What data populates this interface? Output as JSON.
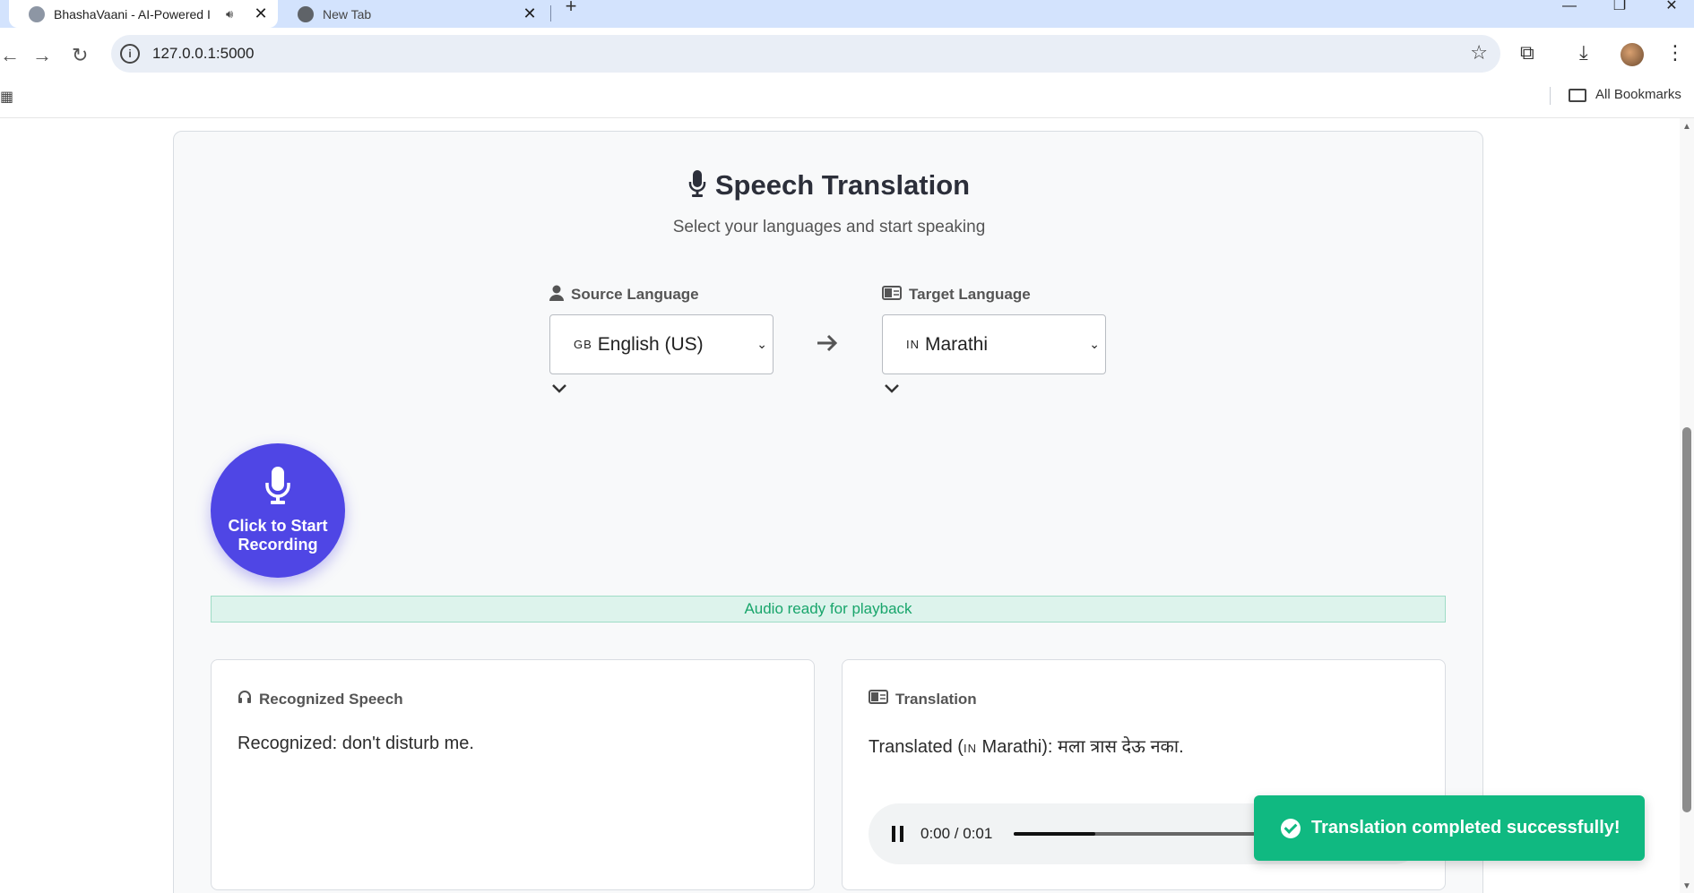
{
  "browser": {
    "tabs": [
      {
        "title": "BhashaVaani - AI-Powered I",
        "active": true
      },
      {
        "title": "New Tab",
        "active": false
      }
    ],
    "new_tab_symbol": "+",
    "url": "127.0.0.1:5000",
    "bookmarks_label": "All Bookmarks"
  },
  "page": {
    "title": "Speech Translation",
    "subtitle": "Select your languages and start speaking",
    "source": {
      "label": "Source Language",
      "flag": "GB",
      "value": "English (US)"
    },
    "target": {
      "label": "Target Language",
      "flag": "IN",
      "value": "Marathi"
    },
    "record_button": "Click to Start Recording",
    "status": "Audio ready for playback",
    "recognized": {
      "heading": "Recognized Speech",
      "text": "Recognized: don't disturb me."
    },
    "translation": {
      "heading": "Translation",
      "prefix": "Translated (",
      "flag": "IN",
      "lang": "Marathi",
      "suffix": "): मला त्रास देऊ नका."
    },
    "audio": {
      "time": "0:00 / 0:01",
      "progress": 0.24
    }
  },
  "toast": {
    "message": "Translation completed successfully!"
  },
  "colors": {
    "accent": "#4f46e5",
    "success": "#10b981",
    "status_text": "#18a56b"
  }
}
